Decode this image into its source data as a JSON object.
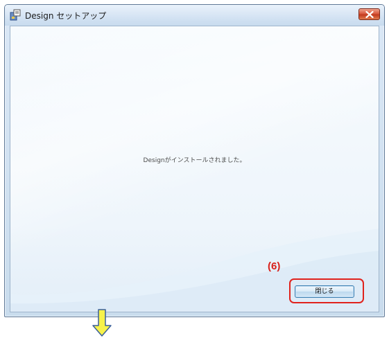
{
  "window": {
    "title": "Design セットアップ",
    "icon": "setup-app-icon",
    "close_icon": "close-icon"
  },
  "content": {
    "message": "Designがインストールされました。"
  },
  "annotation": {
    "step_label": "(6)",
    "highlight_color": "#e0221c",
    "arrow_icon": "down-arrow-icon",
    "arrow_color": "#f7f24a"
  },
  "buttons": {
    "close_label": "閉じる"
  }
}
